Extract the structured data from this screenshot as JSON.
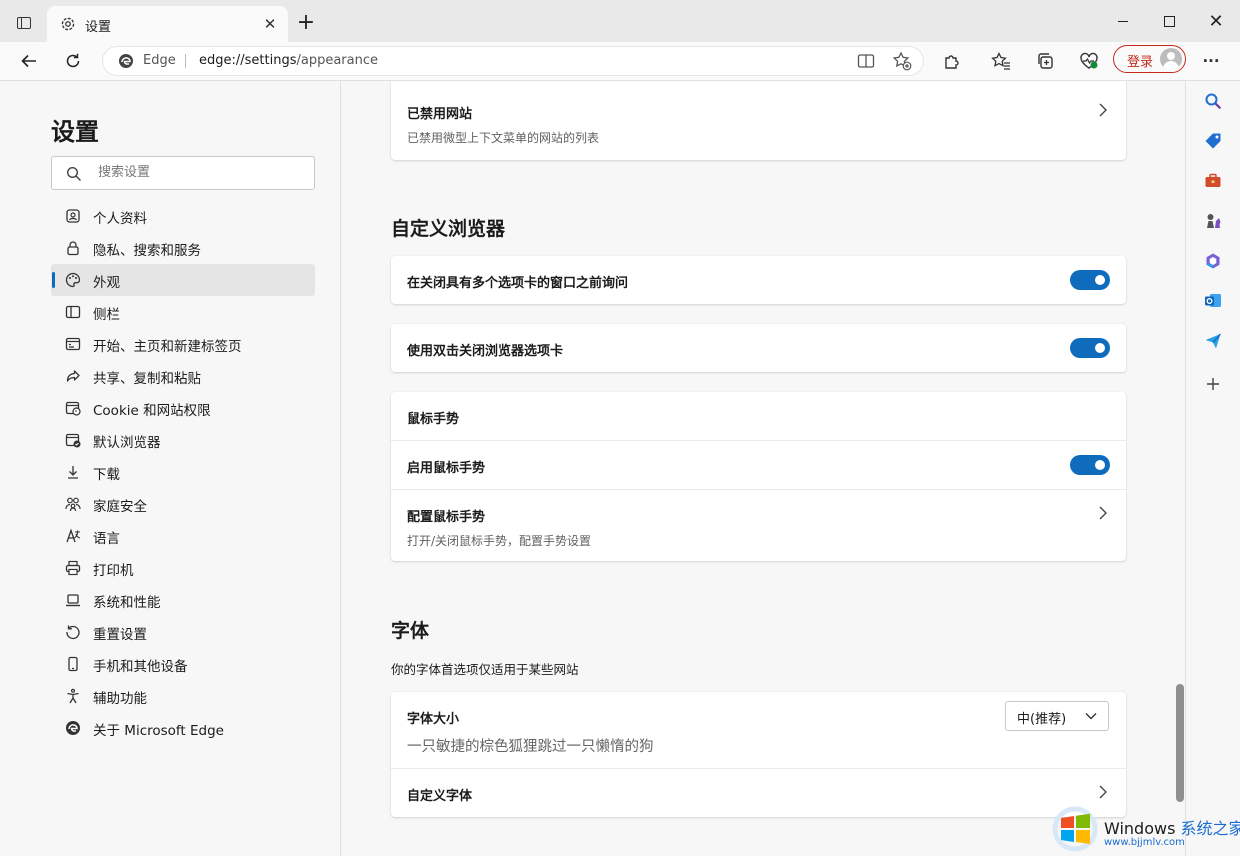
{
  "window": {
    "tab_title": "设置",
    "tab_close": "✕",
    "new_tab": "+",
    "close": "✕"
  },
  "toolbar": {
    "address_brand": "Edge",
    "address_host": "edge://settings",
    "address_path": "/appearance",
    "signin_label": "登录",
    "more": "···"
  },
  "nav": {
    "heading": "设置",
    "search_placeholder": "搜索设置",
    "items": [
      {
        "label": "个人资料",
        "icon": "profile-icon"
      },
      {
        "label": "隐私、搜索和服务",
        "icon": "lock-icon"
      },
      {
        "label": "外观",
        "icon": "palette-icon",
        "selected": true
      },
      {
        "label": "侧栏",
        "icon": "sidebar-icon"
      },
      {
        "label": "开始、主页和新建标签页",
        "icon": "home-tab-icon"
      },
      {
        "label": "共享、复制和粘贴",
        "icon": "share-icon"
      },
      {
        "label": "Cookie 和网站权限",
        "icon": "cookie-icon"
      },
      {
        "label": "默认浏览器",
        "icon": "browser-icon"
      },
      {
        "label": "下载",
        "icon": "download-icon"
      },
      {
        "label": "家庭安全",
        "icon": "family-icon"
      },
      {
        "label": "语言",
        "icon": "language-icon"
      },
      {
        "label": "打印机",
        "icon": "printer-icon"
      },
      {
        "label": "系统和性能",
        "icon": "laptop-icon"
      },
      {
        "label": "重置设置",
        "icon": "reset-icon"
      },
      {
        "label": "手机和其他设备",
        "icon": "phone-icon"
      },
      {
        "label": "辅助功能",
        "icon": "accessibility-icon"
      },
      {
        "label": "关于 Microsoft Edge",
        "icon": "edge-logo-icon"
      }
    ]
  },
  "content": {
    "blocked_sites": {
      "title": "已禁用网站",
      "subtitle": "已禁用微型上下文菜单的网站的列表"
    },
    "customize": {
      "heading": "自定义浏览器",
      "confirm_close": {
        "label": "在关闭具有多个选项卡的窗口之前询问",
        "on": true
      },
      "double_click_close": {
        "label": "使用双击关闭浏览器选项卡",
        "on": true
      },
      "mouse_gesture": {
        "heading": "鼠标手势",
        "enable": {
          "label": "启用鼠标手势",
          "on": true
        },
        "configure": {
          "title": "配置鼠标手势",
          "subtitle": "打开/关闭鼠标手势，配置手势设置"
        }
      }
    },
    "fonts": {
      "heading": "字体",
      "description": "你的字体首选项仅适用于某些网站",
      "size_label": "字体大小",
      "size_value": "中(推荐)",
      "sample": "一只敏捷的棕色狐狸跳过一只懒惰的狗",
      "custom_label": "自定义字体"
    }
  },
  "watermark": {
    "brand": "Windows",
    "site_name": "系统之家",
    "url": "www.bjjmlv.com"
  },
  "colors": {
    "accent": "#0f6cbd",
    "signin": "#c42b1c"
  }
}
